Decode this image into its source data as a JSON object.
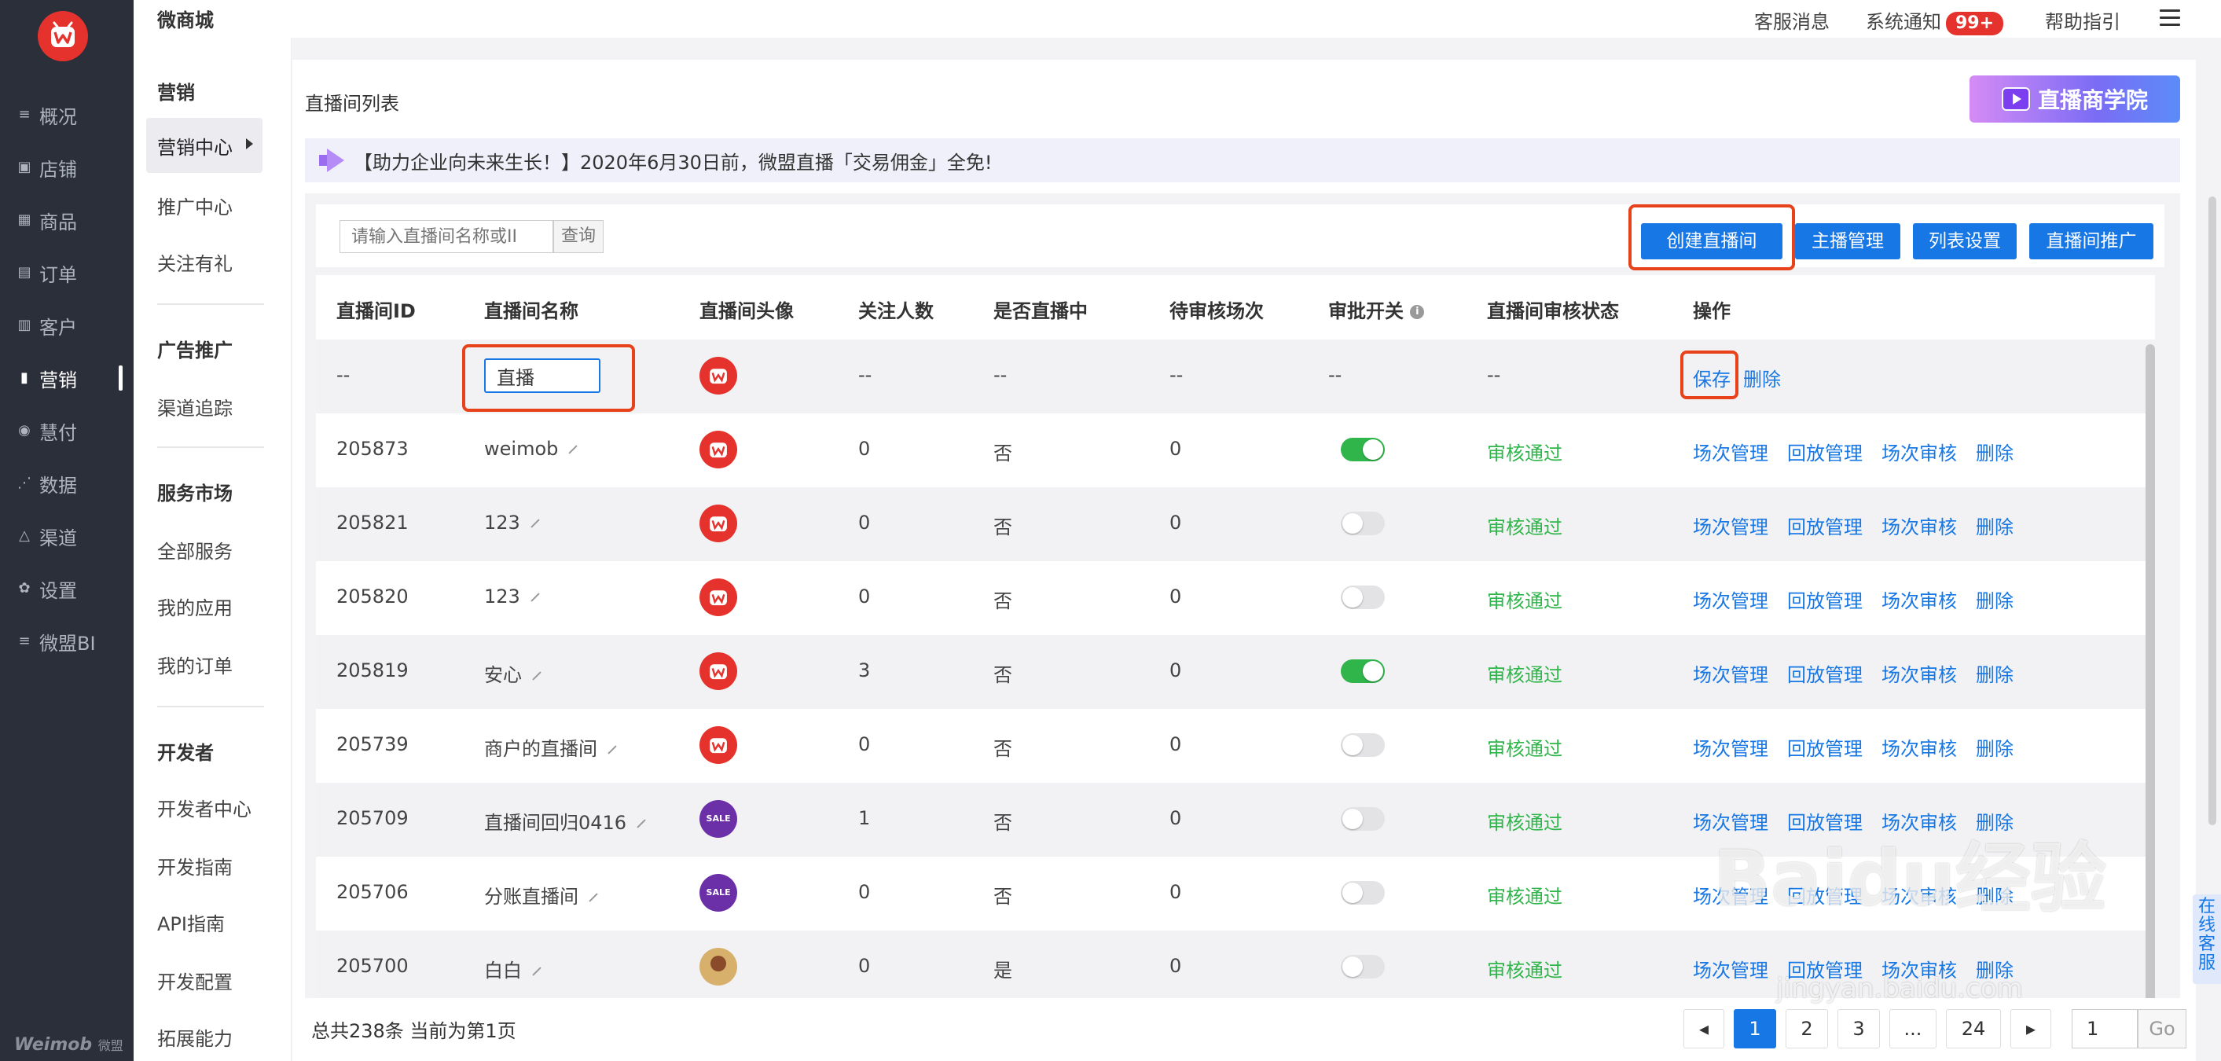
{
  "app_title": "微商城",
  "topbar": {
    "customer_msg": "客服消息",
    "system_notice": "系统通知",
    "notice_badge": "99+",
    "help": "帮助指引"
  },
  "leftnav": {
    "items": [
      {
        "label": "概况",
        "icon": "overview-icon"
      },
      {
        "label": "店铺",
        "icon": "store-icon"
      },
      {
        "label": "商品",
        "icon": "goods-icon"
      },
      {
        "label": "订单",
        "icon": "order-icon"
      },
      {
        "label": "客户",
        "icon": "customer-icon"
      },
      {
        "label": "营销",
        "icon": "marketing-icon",
        "active": true
      },
      {
        "label": "慧付",
        "icon": "pay-icon"
      },
      {
        "label": "数据",
        "icon": "data-icon"
      },
      {
        "label": "渠道",
        "icon": "channel-icon"
      },
      {
        "label": "设置",
        "icon": "settings-icon"
      },
      {
        "label": "微盟BI",
        "icon": "bi-icon"
      }
    ],
    "footer_brand": "Weimob",
    "footer_brand_cn": "微盟"
  },
  "subnav": {
    "sec1_title": "营销",
    "sec1_items": [
      "营销中心",
      "推广中心",
      "关注有礼"
    ],
    "sec2_title": "广告推广",
    "sec2_items": [
      "渠道追踪"
    ],
    "sec3_title": "服务市场",
    "sec3_items": [
      "全部服务",
      "我的应用",
      "我的订单"
    ],
    "sec4_title": "开发者",
    "sec4_items": [
      "开发者中心",
      "开发指南",
      "API指南",
      "开发配置",
      "拓展能力"
    ]
  },
  "page": {
    "title": "直播间列表",
    "academy_banner": "直播商学院",
    "notice": "【助力企业向未来生长！】2020年6月30日前，微盟直播「交易佣金」全免!"
  },
  "toolbar": {
    "search_placeholder": "请输入直播间名称或II",
    "search_button": "查询",
    "create_button": "创建直播间",
    "anchor_button": "主播管理",
    "list_settings_button": "列表设置",
    "promote_button": "直播间推广"
  },
  "table": {
    "headers": [
      "直播间ID",
      "直播间名称",
      "直播间头像",
      "关注人数",
      "是否直播中",
      "待审核场次",
      "审批开关",
      "直播间审核状态",
      "操作"
    ],
    "new_row": {
      "id": "--",
      "name_value": "直播",
      "followers": "--",
      "live": "--",
      "pending": "--",
      "approval": "--",
      "status": "--",
      "save": "保存",
      "delete": "删除"
    },
    "ops": {
      "sessions": "场次管理",
      "playback": "回放管理",
      "review": "场次审核",
      "delete": "删除"
    },
    "rows": [
      {
        "id": "205873",
        "name": "weimob",
        "avatar": "red",
        "followers": "0",
        "live": "否",
        "pending": "0",
        "approval_on": true,
        "status": "审核通过"
      },
      {
        "id": "205821",
        "name": "123",
        "avatar": "red",
        "followers": "0",
        "live": "否",
        "pending": "0",
        "approval_on": false,
        "status": "审核通过"
      },
      {
        "id": "205820",
        "name": "123",
        "avatar": "red",
        "followers": "0",
        "live": "否",
        "pending": "0",
        "approval_on": false,
        "status": "审核通过"
      },
      {
        "id": "205819",
        "name": "安心",
        "avatar": "red",
        "followers": "3",
        "live": "否",
        "pending": "0",
        "approval_on": true,
        "status": "审核通过"
      },
      {
        "id": "205739",
        "name": "商户的直播间",
        "avatar": "red",
        "followers": "0",
        "live": "否",
        "pending": "0",
        "approval_on": false,
        "status": "审核通过"
      },
      {
        "id": "205709",
        "name": "直播间回归0416",
        "avatar": "sale",
        "followers": "1",
        "live": "否",
        "pending": "0",
        "approval_on": false,
        "status": "审核通过"
      },
      {
        "id": "205706",
        "name": "分账直播间",
        "avatar": "sale",
        "followers": "0",
        "live": "否",
        "pending": "0",
        "approval_on": false,
        "status": "审核通过"
      },
      {
        "id": "205700",
        "name": "白白",
        "avatar": "person",
        "followers": "0",
        "live": "是",
        "pending": "0",
        "approval_on": false,
        "status": "审核通过"
      }
    ]
  },
  "pagination": {
    "total_text": "总共238条 当前为第1页",
    "pages": [
      "1",
      "2",
      "3",
      "...",
      "24"
    ],
    "prev": "◂",
    "next": "▸",
    "jump_value": "1",
    "go": "Go"
  },
  "service_tab": "在线客服",
  "watermark": "Baidu经验",
  "watermark_url": "jingyan.baidu.com"
}
